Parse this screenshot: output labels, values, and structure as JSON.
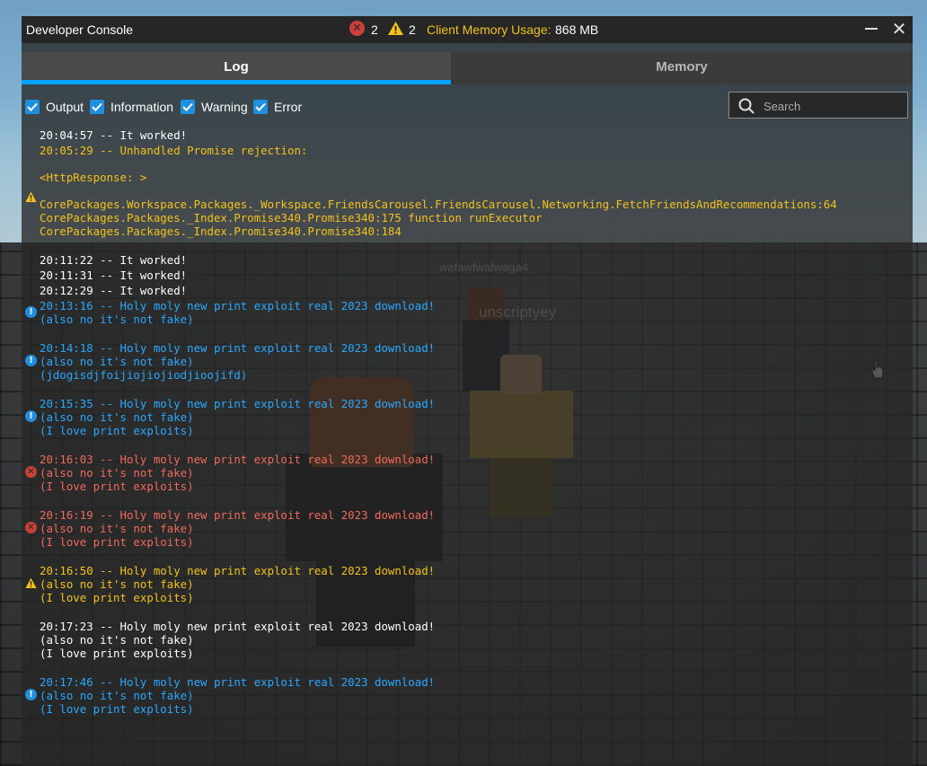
{
  "window": {
    "title": "Developer Console",
    "error_count": "2",
    "warning_count": "2",
    "memory_label": "Client Memory Usage:",
    "memory_value": "868 MB"
  },
  "tabs": [
    {
      "label": "Log",
      "active": true
    },
    {
      "label": "Memory",
      "active": false
    }
  ],
  "filters": [
    {
      "label": "Output",
      "checked": true
    },
    {
      "label": "Information",
      "checked": true
    },
    {
      "label": "Warning",
      "checked": true
    },
    {
      "label": "Error",
      "checked": true
    }
  ],
  "search": {
    "placeholder": "Search"
  },
  "log": {
    "e0": "20:04:57 -- It worked!",
    "e1": "20:05:29 -- Unhandled Promise rejection:\n\n<HttpResponse: >\n\nCorePackages.Workspace.Packages._Workspace.FriendsCarousel.FriendsCarousel.Networking.FetchFriendsAndRecommendations:64\nCorePackages.Packages._Index.Promise340.Promise340:175 function runExecutor\nCorePackages.Packages._Index.Promise340.Promise340:184",
    "e2": "20:11:22 -- It worked!",
    "e3": "20:11:31 -- It worked!",
    "e4": "20:12:29 -- It worked!",
    "e5": "20:13:16 -- Holy moly new print exploit real 2023 download!\n(also no it's not fake)",
    "e6": "20:14:18 -- Holy moly new print exploit real 2023 download!\n(also no it's not fake)\n(jdogisdjfoijiojiojiodjioojifd)",
    "e7": "20:15:35 -- Holy moly new print exploit real 2023 download!\n(also no it's not fake)\n(I love print exploits)",
    "e8": "20:16:03 -- Holy moly new print exploit real 2023 download!\n(also no it's not fake)\n(I love print exploits)",
    "e9": "20:16:19 -- Holy moly new print exploit real 2023 download!\n(also no it's not fake)\n(I love print exploits)",
    "e10": "20:16:50 -- Holy moly new print exploit real 2023 download!\n(also no it's not fake)\n(I love print exploits)",
    "e11": "20:17:23 -- Holy moly new print exploit real 2023 download!\n(also no it's not fake)\n(I love print exploits)",
    "e12": "20:17:46 -- Holy moly new print exploit real 2023 download!\n(also no it's not fake)\n(I love print exploits)"
  },
  "scene": {
    "player_name_1": "wafawfwafwaga4",
    "player_name_2": "unscriptyey"
  },
  "colors": {
    "accent": "#00a2ff",
    "warning": "#f2c21b",
    "error": "#f06a5c",
    "info": "#2aa8ff"
  }
}
